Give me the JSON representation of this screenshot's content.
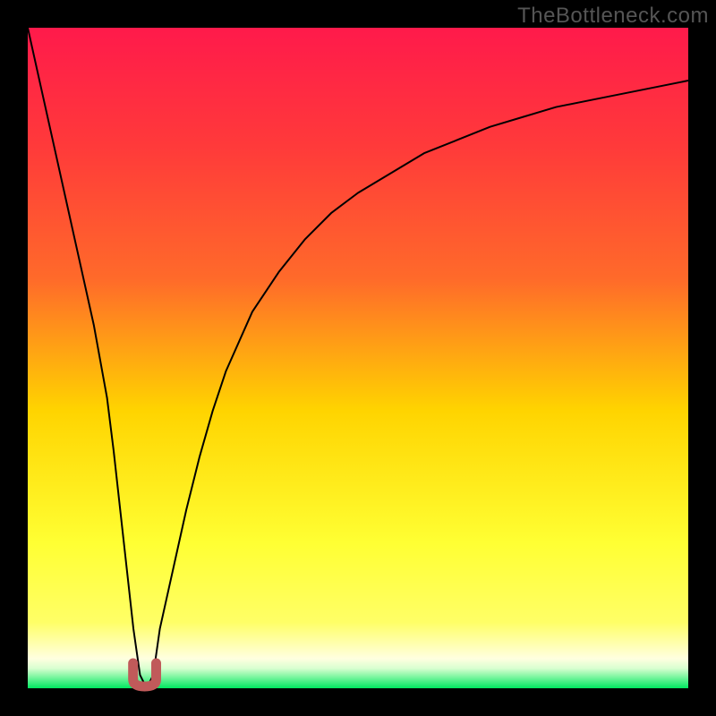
{
  "watermark": "TheBottleneck.com",
  "colors": {
    "black": "#000000",
    "grad_top": "#ff1a4b",
    "grad_mid_upper": "#ff6a2a",
    "grad_mid": "#ffd400",
    "grad_lower": "#ffff66",
    "grad_pale": "#ffffe0",
    "grad_green": "#00e860",
    "curve": "#000000",
    "marker": "#c05a5a"
  },
  "chart_data": {
    "type": "line",
    "title": "",
    "xlabel": "",
    "ylabel": "",
    "xlim": [
      0,
      100
    ],
    "ylim": [
      0,
      100
    ],
    "x": [
      0,
      2,
      4,
      6,
      8,
      10,
      12,
      13,
      14,
      15,
      16,
      17,
      18,
      19,
      20,
      22,
      24,
      26,
      28,
      30,
      34,
      38,
      42,
      46,
      50,
      55,
      60,
      65,
      70,
      75,
      80,
      85,
      90,
      95,
      100
    ],
    "values": [
      100,
      91,
      82,
      73,
      64,
      55,
      44,
      36,
      27,
      18,
      9,
      2,
      0,
      2,
      9,
      18,
      27,
      35,
      42,
      48,
      57,
      63,
      68,
      72,
      75,
      78,
      81,
      83,
      85,
      86.5,
      88,
      89,
      90,
      91,
      92
    ],
    "marker": {
      "x_center": 17.7,
      "width": 3.5,
      "y_top": 3.8,
      "y_bottom": 0
    }
  }
}
